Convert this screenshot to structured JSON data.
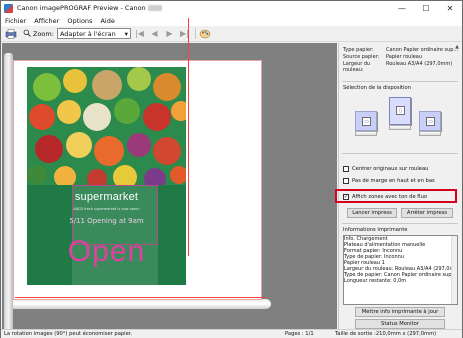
{
  "window": {
    "title": "Canon imagePROGRAF Preview - Canon",
    "minimize": "—",
    "maximize": "☐",
    "close": "✕"
  },
  "menu": [
    "Fichier",
    "Afficher",
    "Options",
    "Aide"
  ],
  "toolbar": {
    "zoom_label": "Zoom:",
    "zoom_value": "Adapter à l'écran"
  },
  "poster": {
    "title": "supermarket",
    "subtitle": "ABCD fresh supermarket is now open!",
    "date": "5/11   Opening at 9am",
    "open": "Open"
  },
  "panel": {
    "info": [
      {
        "key": "Type papier:",
        "value": "Canon Papier ordinaire sup..."
      },
      {
        "key": "Source papier:",
        "value": "Papier rouleau"
      },
      {
        "key": "Largeur du rouleau:",
        "value": "Rouleau A3/A4 (297,0mm)"
      }
    ],
    "layout_label": "Sélection de la disposition",
    "checkbox_center": "Centrer originaux sur rouleau",
    "checkbox_margin": "Pas de marge en haut et en bas",
    "checkbox_zones": "Affich zones avec ton de fluo",
    "btn_print": "Lancer impress",
    "btn_stop": "Arrêter impress",
    "printer_info_label": "Informations imprimante",
    "printer_info_lines": [
      "Info. Chargement",
      "  Plateau d'alimentation manuelle",
      "    Format papier: Inconnu",
      "    Type de papier: Inconnu",
      "",
      "  Papier rouleau 1",
      "    Largeur du rouleau: Rouleau A3/A4 (297,0mm)",
      "    Type de papier: Canon Papier ordinaire sup...",
      "    Longueur restante: 0,0m"
    ],
    "btn_update": "Mettre info imprimante à jour",
    "btn_status": "Status Monitor"
  },
  "status": {
    "hint": "La rotation images (90°) peut économiser papier.",
    "pages": "Pages : 1/1",
    "size": "Taille de sortie :210,0mm x (297,0mm)"
  },
  "colors": {
    "highlight": "#d9001b",
    "poster_green": "#1f7a45",
    "open_pink": "#e23fa3",
    "layout_blue": "#c9cff6"
  }
}
